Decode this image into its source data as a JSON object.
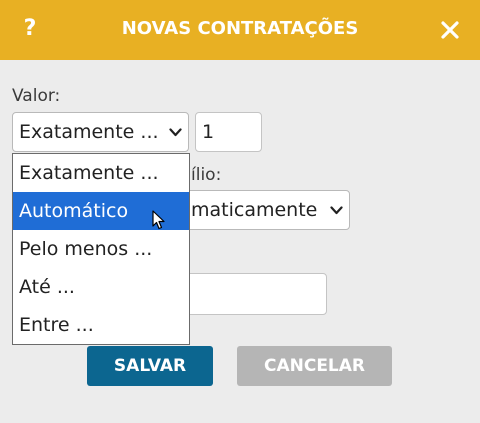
{
  "dialog": {
    "title": "NOVAS CONTRATAÇÕES",
    "help_glyph": "?",
    "close_icon": "close-icon",
    "accent_color": "#e8b023"
  },
  "valor": {
    "label": "Valor:",
    "select_value": "Exatamente ...",
    "amount_value": "1"
  },
  "dropdown": {
    "options": [
      {
        "label": "Exatamente ..."
      },
      {
        "label": "Automático",
        "highlighted": true
      },
      {
        "label": "Pelo menos ..."
      },
      {
        "label": "Até ..."
      },
      {
        "label": "Entre ..."
      }
    ],
    "highlight_color": "#1f6dd6"
  },
  "auxilio": {
    "label_fragment": "ílio:",
    "select_value_fragment": "maticamente"
  },
  "buttons": {
    "save_label": "SALVAR",
    "cancel_label": "CANCELAR"
  }
}
